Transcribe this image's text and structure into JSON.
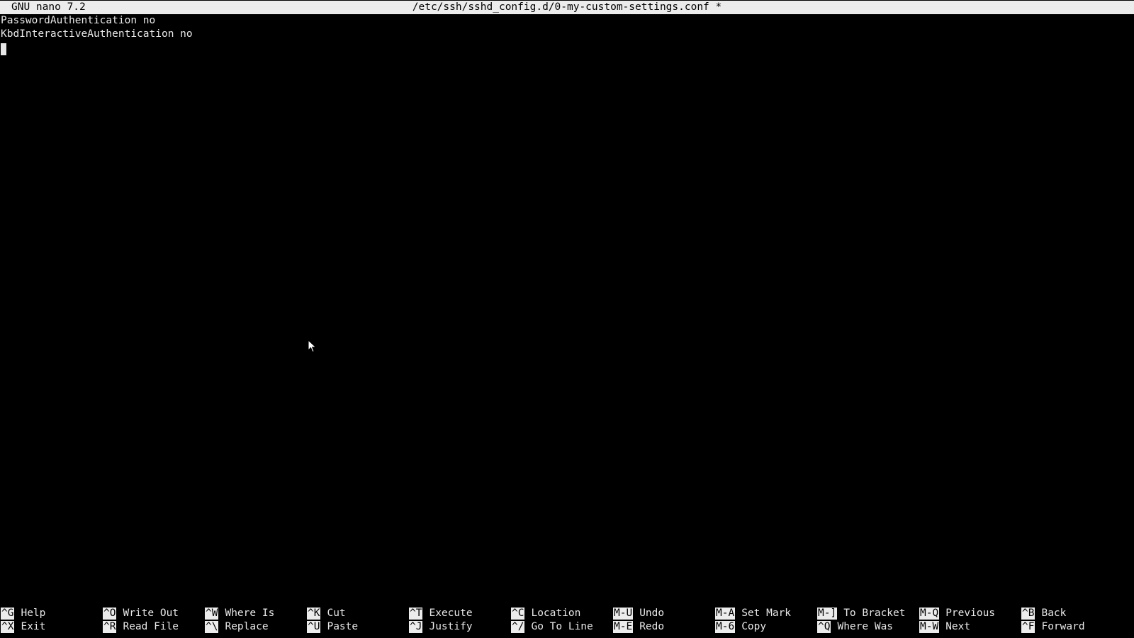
{
  "title_bar": {
    "app_name": "GNU nano 7.2",
    "file_title": "/etc/ssh/sshd_config.d/0-my-custom-settings.conf *"
  },
  "editor": {
    "lines": [
      "PasswordAuthentication no",
      "KbdInteractiveAuthentication no",
      ""
    ]
  },
  "shortcuts": {
    "top": [
      {
        "key": "^G",
        "label": "Help"
      },
      {
        "key": "^O",
        "label": "Write Out"
      },
      {
        "key": "^W",
        "label": "Where Is"
      },
      {
        "key": "^K",
        "label": "Cut"
      },
      {
        "key": "^T",
        "label": "Execute"
      },
      {
        "key": "^C",
        "label": "Location"
      },
      {
        "key": "M-U",
        "label": "Undo"
      },
      {
        "key": "M-A",
        "label": "Set Mark"
      },
      {
        "key": "M-]",
        "label": "To Bracket"
      },
      {
        "key": "M-Q",
        "label": "Previous"
      },
      {
        "key": "^B",
        "label": "Back"
      }
    ],
    "bottom": [
      {
        "key": "^X",
        "label": "Exit"
      },
      {
        "key": "^R",
        "label": "Read File"
      },
      {
        "key": "^\\",
        "label": "Replace"
      },
      {
        "key": "^U",
        "label": "Paste"
      },
      {
        "key": "^J",
        "label": "Justify"
      },
      {
        "key": "^/",
        "label": "Go To Line"
      },
      {
        "key": "M-E",
        "label": "Redo"
      },
      {
        "key": "M-6",
        "label": "Copy"
      },
      {
        "key": "^Q",
        "label": "Where Was"
      },
      {
        "key": "M-W",
        "label": "Next"
      },
      {
        "key": "^F",
        "label": "Forward"
      }
    ]
  },
  "colors": {
    "background": "#000000",
    "foreground": "#e8e8e8",
    "inverse_bg": "#ececec",
    "inverse_fg": "#000000"
  },
  "icons": {
    "pointer": "mouse-pointer-icon"
  }
}
